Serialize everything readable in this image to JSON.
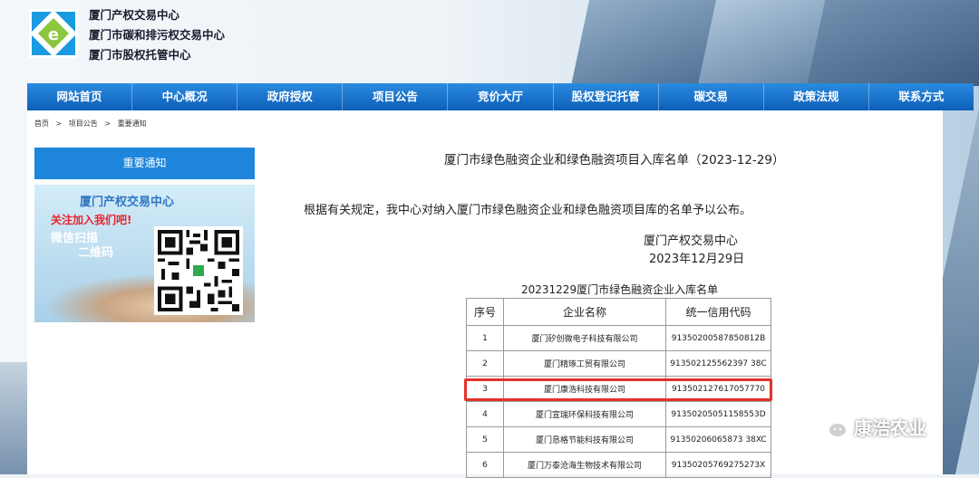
{
  "header": {
    "org_names": [
      "厦门产权交易中心",
      "厦门市碳和排污权交易中心",
      "厦门市股权托管中心"
    ]
  },
  "nav": [
    "网站首页",
    "中心概况",
    "政府授权",
    "项目公告",
    "竞价大厅",
    "股权登记托管",
    "碳交易",
    "政策法规",
    "联系方式"
  ],
  "breadcrumb": [
    "首页",
    ">",
    "项目公告",
    ">",
    "重要通知"
  ],
  "sidebar": {
    "title": "重要通知",
    "qr_promo": {
      "line1": "厦门产权交易中心",
      "line2": "关注加入我们吧!",
      "line3": "微信扫描",
      "line4": "二维码"
    }
  },
  "article": {
    "title": "厦门市绿色融资企业和绿色融资项目入库名单（2023-12-29）",
    "body": "根据有关规定，我中心对纳入厦门市绿色融资企业和绿色融资项目库的名单予以公布。",
    "signature_org": "厦门产权交易中心",
    "signature_date": "2023年12月29日",
    "table_title": "20231229厦门市绿色融资企业入库名单",
    "table": {
      "headers": [
        "序号",
        "企业名称",
        "统一信用代码"
      ],
      "rows": [
        [
          "1",
          "厦门矽创微电子科技有限公司",
          "91350200587850812B"
        ],
        [
          "2",
          "厦门精琢工贸有限公司",
          "913502125562397 38C"
        ],
        [
          "3",
          "厦门康浩科技有限公司",
          "913502127617057770"
        ],
        [
          "4",
          "厦门宣瑞环保科技有限公司",
          "91350205051158553D"
        ],
        [
          "5",
          "厦门恳格节能科技有限公司",
          "91350206065873 38XC"
        ],
        [
          "6",
          "厦门万泰沧海生物技术有限公司",
          "91350205769275273X"
        ]
      ]
    }
  },
  "watermark": "康浩农业",
  "colors": {
    "nav_blue": "#1576d2",
    "highlight_red": "#e4322b",
    "sidebar_blue": "#1e86dc"
  }
}
